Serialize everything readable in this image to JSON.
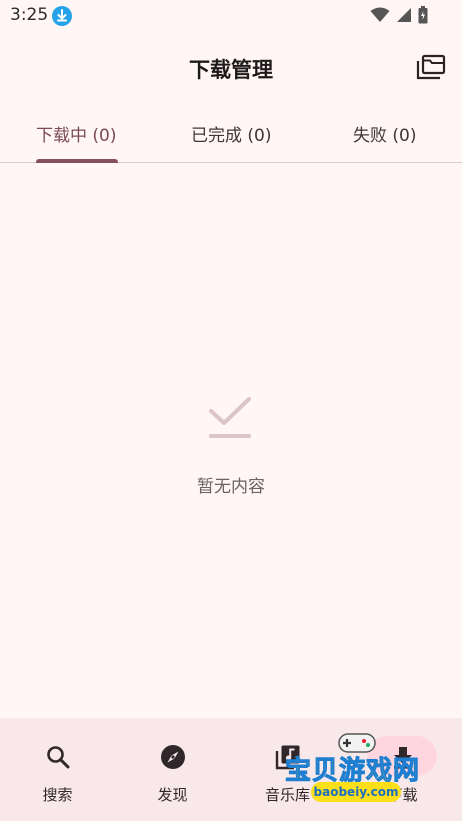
{
  "status_bar": {
    "time": "3:25"
  },
  "app_bar": {
    "title": "下载管理"
  },
  "tabs": [
    {
      "label": "下载中 (0)",
      "selected": true
    },
    {
      "label": "已完成 (0)",
      "selected": false
    },
    {
      "label": "失败 (0)",
      "selected": false
    }
  ],
  "empty_state": {
    "text": "暂无内容"
  },
  "bottom_nav": {
    "items": [
      {
        "label": "搜索",
        "icon": "search-icon"
      },
      {
        "label": "发现",
        "icon": "compass-icon"
      },
      {
        "label": "音乐库",
        "icon": "library-music-icon"
      },
      {
        "label": "下载",
        "icon": "download-icon",
        "selected": true
      }
    ]
  },
  "watermark": {
    "title": "宝贝游戏网",
    "url": "baobeiy.com"
  },
  "colors": {
    "background": "#fff6f5",
    "accent": "#86505d",
    "nav_background": "#f8e8ea",
    "nav_selected_pill": "#ffd6df",
    "status_download_badge": "#26a3e8"
  }
}
